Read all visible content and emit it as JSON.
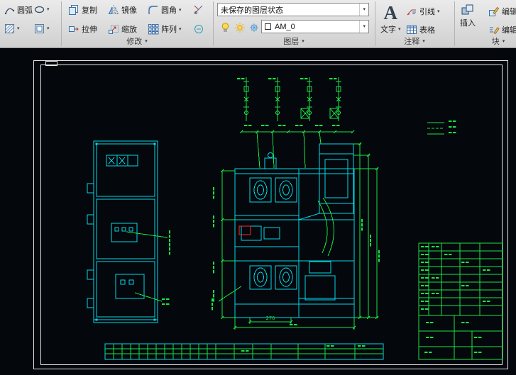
{
  "ribbon": {
    "draw": {
      "arc": "圆弧"
    },
    "modify": {
      "label": "修改",
      "copy": "复制",
      "mirror": "镜像",
      "fillet": "圆角",
      "stretch": "拉伸",
      "scale": "缩放",
      "array": "阵列"
    },
    "layers": {
      "label": "图层",
      "state_dropdown": "未保存的图层状态",
      "current_layer": "AM_0"
    },
    "annotate": {
      "label": "注释",
      "big_a": "A",
      "text": "文字",
      "leader": "引线",
      "table": "表格"
    },
    "block": {
      "label": "块",
      "insert": "插入",
      "edit": "编辑",
      "edit_attr": "编辑"
    }
  },
  "icons": {
    "chevron_down": "▾"
  },
  "drawing": {
    "bottom_dim": "276"
  },
  "colors": {
    "cyan": "#00d8e8",
    "green": "#19e645",
    "red": "#ff2a2a",
    "frame": "#e6e6e6"
  }
}
